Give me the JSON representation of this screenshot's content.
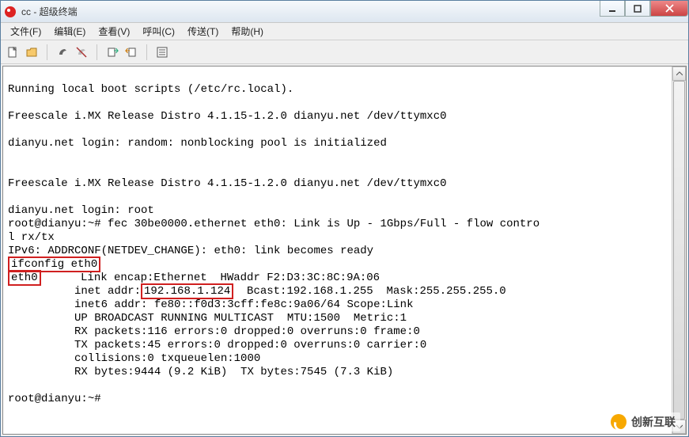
{
  "window": {
    "title": "cc - 超级终端"
  },
  "menubar": {
    "file": "文件(F)",
    "edit": "编辑(E)",
    "view": "查看(V)",
    "call": "呼叫(C)",
    "transfer": "传送(T)",
    "help": "帮助(H)"
  },
  "toolbar_icons": {
    "new": "new-file-icon",
    "open": "open-folder-icon",
    "connect": "call-connect-icon",
    "disconnect": "call-disconnect-icon",
    "send": "send-icon",
    "receive": "receive-icon",
    "properties": "properties-icon"
  },
  "terminal": {
    "lines": [
      "",
      "Running local boot scripts (/etc/rc.local).",
      "",
      "Freescale i.MX Release Distro 4.1.15-1.2.0 dianyu.net /dev/ttymxc0",
      "",
      "dianyu.net login: random: nonblocking pool is initialized",
      "",
      "",
      "Freescale i.MX Release Distro 4.1.15-1.2.0 dianyu.net /dev/ttymxc0",
      "",
      "dianyu.net login: root",
      "root@dianyu:~# fec 30be0000.ethernet eth0: Link is Up - 1Gbps/Full - flow contro",
      "l rx/tx",
      "IPv6: ADDRCONF(NETDEV_CHANGE): eth0: link becomes ready"
    ],
    "hl_ifconfig": "ifconfig eth0",
    "hl_eth0": "eth0",
    "eth0_rest": "      Link encap:Ethernet  HWaddr F2:D3:3C:8C:9A:06",
    "inet_pre": "          inet addr:",
    "hl_ip": "192.168.1.124",
    "inet_post": "  Bcast:192.168.1.255  Mask:255.255.255.0",
    "inet6": "          inet6 addr: fe80::f0d3:3cff:fe8c:9a06/64 Scope:Link",
    "updown": "          UP BROADCAST RUNNING MULTICAST  MTU:1500  Metric:1",
    "rx": "          RX packets:116 errors:0 dropped:0 overruns:0 frame:0",
    "tx": "          TX packets:45 errors:0 dropped:0 overruns:0 carrier:0",
    "coll": "          collisions:0 txqueuelen:1000",
    "bytes": "          RX bytes:9444 (9.2 KiB)  TX bytes:7545 (7.3 KiB)",
    "prompt": "root@dianyu:~# "
  },
  "watermark": {
    "text": "创新互联"
  }
}
